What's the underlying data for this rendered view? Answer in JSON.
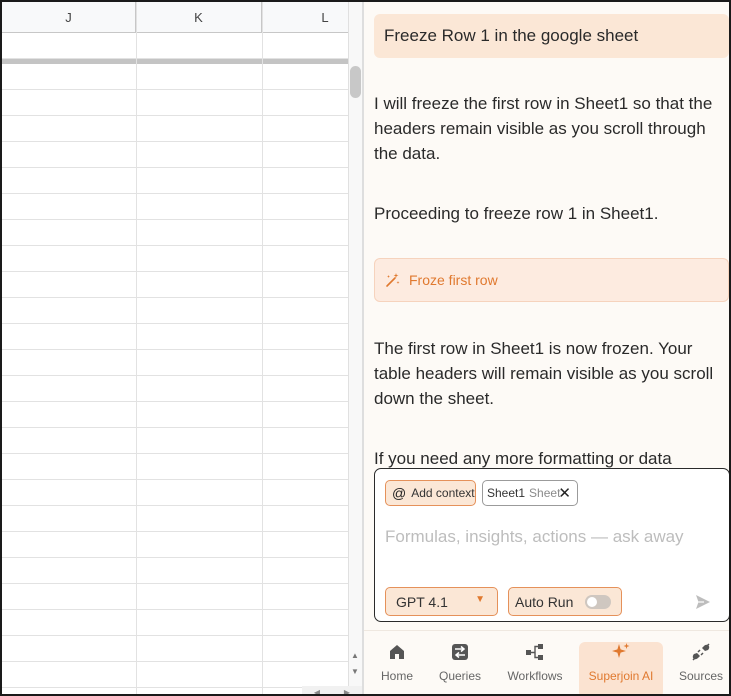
{
  "spreadsheet": {
    "columns": [
      "J",
      "K",
      "L"
    ]
  },
  "chat": {
    "user_message": "Freeze Row 1 in the google sheet",
    "assistant_messages": [
      "I will freeze the first row in Sheet1 so that the headers remain visible as you scroll through the data.",
      "Proceeding to freeze row 1 in Sheet1.",
      "The first row in Sheet1 is now frozen. Your table headers will remain visible as you scroll down the sheet.",
      "If you need any more formatting or data"
    ],
    "action_card": {
      "label": "Froze first row",
      "icon": "magic-wand-icon"
    }
  },
  "composer": {
    "add_context_label": "Add context",
    "context_chip": {
      "name": "Sheet1",
      "type": "Sheet"
    },
    "placeholder": "Formulas, insights, actions — ask away",
    "model": "GPT 4.1",
    "auto_run_label": "Auto Run",
    "auto_run_enabled": false
  },
  "nav": {
    "items": [
      {
        "label": "Home",
        "icon": "home-icon",
        "active": false
      },
      {
        "label": "Queries",
        "icon": "queries-icon",
        "active": false
      },
      {
        "label": "Workflows",
        "icon": "workflows-icon",
        "active": false
      },
      {
        "label": "Superjoin AI",
        "icon": "sparkle-icon",
        "active": true
      },
      {
        "label": "Sources",
        "icon": "plug-icon",
        "active": false
      }
    ]
  },
  "colors": {
    "accent": "#e0792f",
    "accent_soft": "#fbe7d6",
    "panel_bg": "#fdfaf6"
  }
}
